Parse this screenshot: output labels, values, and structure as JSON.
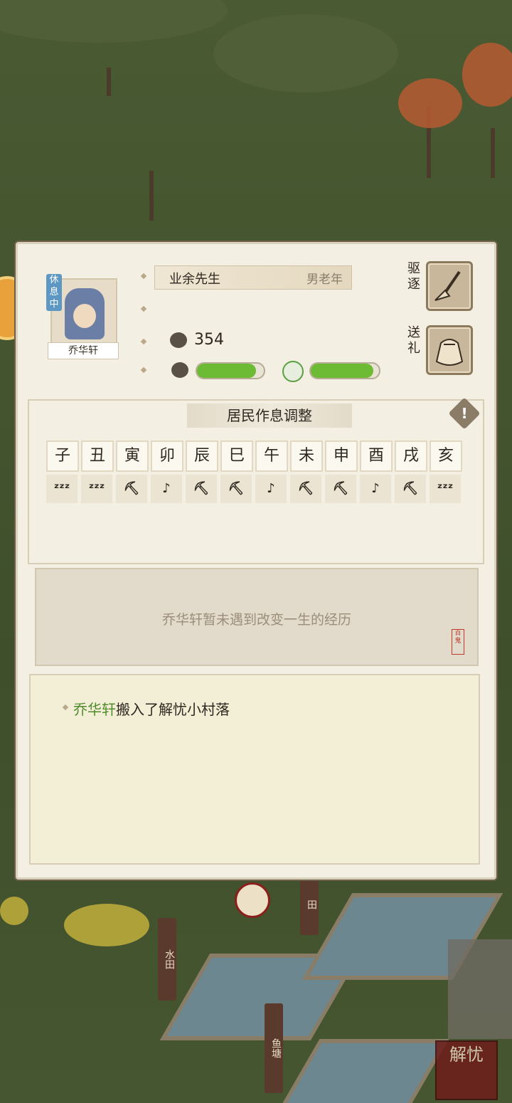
{
  "resident": {
    "status_tag": "休息中",
    "name": "乔华轩",
    "title": "业余先生",
    "type": "男老年",
    "stat_value": "354",
    "health_fraction": 0.88,
    "mood_fraction": 0.92
  },
  "actions": [
    {
      "label": "驱逐",
      "icon": "broom-icon"
    },
    {
      "label": "送礼",
      "icon": "gift-bag-icon"
    }
  ],
  "schedule": {
    "title": "居民作息调整",
    "hours": [
      "子",
      "丑",
      "寅",
      "卯",
      "辰",
      "巳",
      "午",
      "未",
      "申",
      "酉",
      "戌",
      "亥"
    ],
    "activities": [
      "sleep",
      "sleep",
      "work",
      "leisure",
      "work",
      "work",
      "leisure",
      "work",
      "work",
      "leisure",
      "work",
      "sleep"
    ]
  },
  "story": {
    "text": "乔华轩暂未遇到改变一生的经历",
    "stamp": "百鬼"
  },
  "log": {
    "name": "乔华轩",
    "text": "搬入了解忧小村落"
  },
  "map": {
    "signs": [
      "水田",
      "鱼塘",
      "田"
    ],
    "brand": "解忧"
  }
}
